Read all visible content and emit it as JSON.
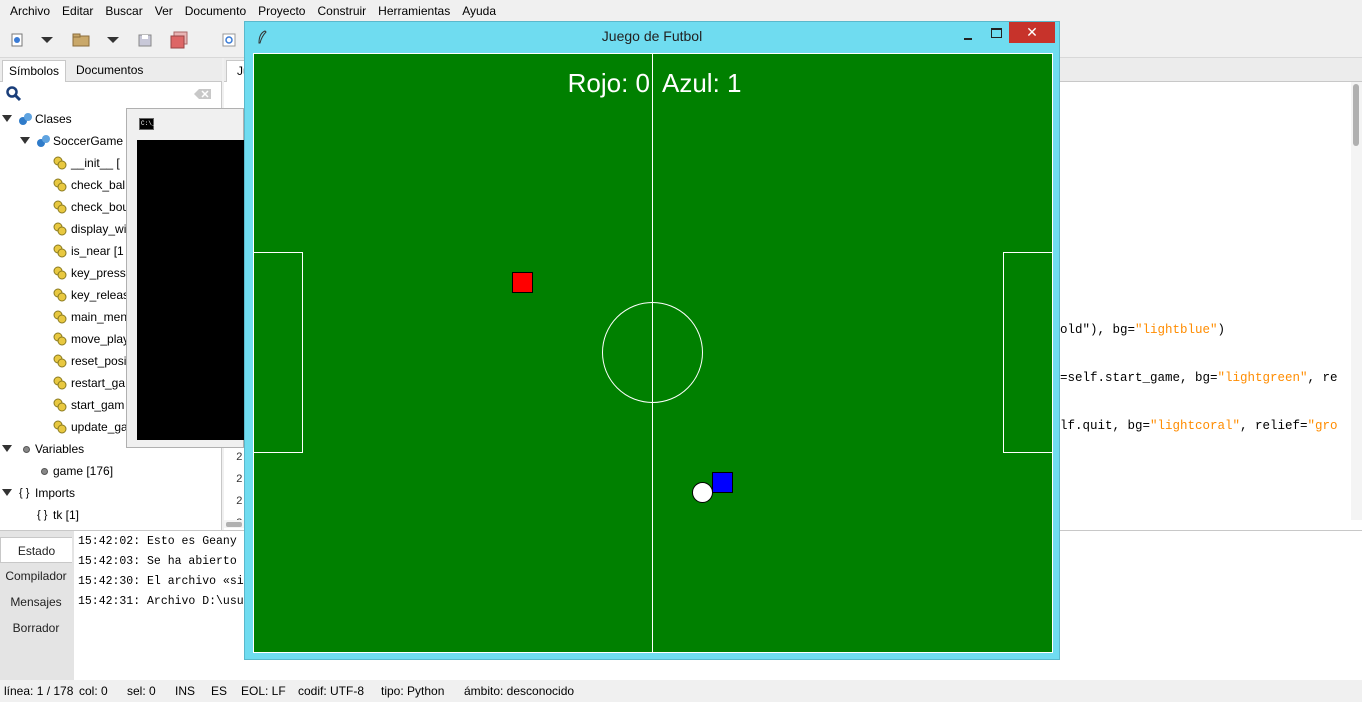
{
  "menu": [
    "Archivo",
    "Editar",
    "Buscar",
    "Ver",
    "Documento",
    "Proyecto",
    "Construir",
    "Herramientas",
    "Ayuda"
  ],
  "sidebar": {
    "tabs": [
      "Símbolos",
      "Documentos"
    ],
    "search_value": "",
    "classes_label": "Clases",
    "class_name": "SoccerGame [",
    "methods": [
      "__init__ [",
      "check_bal",
      "check_bou",
      "display_wi",
      "is_near [1",
      "key_press",
      "key_releas",
      "main_men",
      "move_play",
      "reset_posi",
      "restart_ga",
      "start_gam",
      "update_ga"
    ],
    "variables_label": "Variables",
    "variables": [
      "game [176]"
    ],
    "imports_label": "Imports",
    "imports": [
      "tk [1]"
    ]
  },
  "editor": {
    "tab_label": "Ju",
    "line1_pre": "old\"), bg=",
    "line1_str": "\"lightblue\"",
    "line1_post": ")",
    "line2_pre": "=self.start_game, bg=",
    "line2_str": "\"lightgreen\"",
    "line2_post": ", re",
    "line3_pre": "lf.quit, bg=",
    "line3_str": "\"lightcoral\"",
    "line3_post": ", relief=",
    "line3_str2": "\"gro",
    "line_numbers": [
      "2",
      "2",
      "2",
      "2"
    ]
  },
  "messages": {
    "tabs": [
      "Estado",
      "Compilador",
      "Mensajes",
      "Borrador"
    ],
    "lines": [
      "15:42:02: Esto es Geany",
      "15:42:03: Se ha abierto",
      "15:42:30: El archivo «si",
      "15:42:31: Archivo D:\\usu"
    ]
  },
  "statusbar": {
    "line": "línea: 1 / 178",
    "col": "col: 0",
    "sel": "sel: 0",
    "ins": "INS",
    "lang": "ES",
    "eol": "EOL: LF",
    "encoding": "codif: UTF-8",
    "filetype": "tipo: Python",
    "scope": "ámbito: desconocido"
  },
  "game_window": {
    "title": "Juego de Futbol",
    "score_red": "Rojo: 0",
    "score_blue": "Azul: 1",
    "colors": {
      "field": "#008000",
      "red_player": "#ff0000",
      "blue_player": "#0000ff",
      "ball": "#ffffff",
      "titlebar": "#6fdcf0",
      "close": "#c7332b"
    }
  }
}
